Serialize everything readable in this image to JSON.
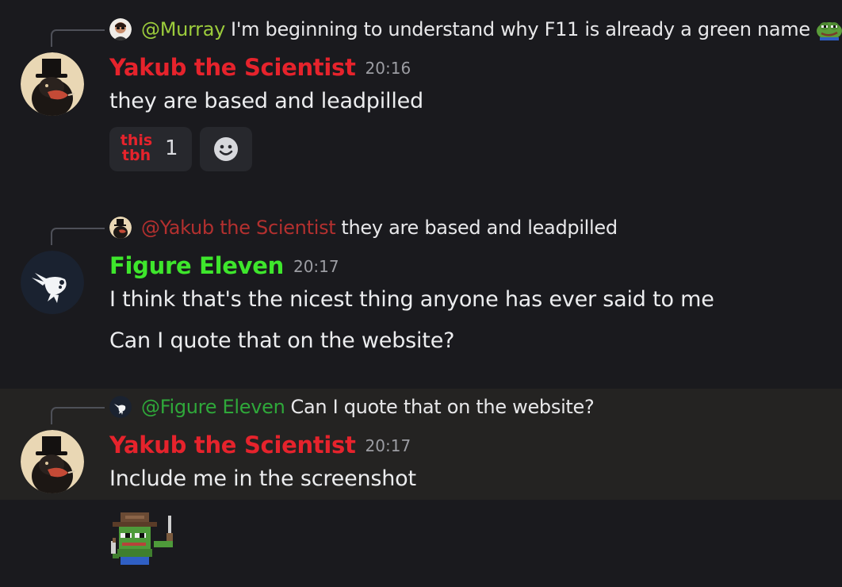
{
  "messages": [
    {
      "reply": {
        "mention": "@Murray",
        "text": "I'm beginning to understand why F11 is already a green name",
        "mention_color": "#9ccc3c",
        "emoji": "pepe-smug-emoji"
      },
      "author": "Yakub the Scientist",
      "author_color": "#e6232c",
      "timestamp": "20:16",
      "lines": [
        "they are based and leadpilled"
      ],
      "reaction": {
        "emoji_line1": "this",
        "emoji_line2": "tbh",
        "count": "1"
      }
    },
    {
      "reply": {
        "mention": "@Yakub the Scientist",
        "text": "they are based and leadpilled",
        "mention_color": "#b3302f"
      },
      "author": "Figure Eleven",
      "author_color": "#3ee62c",
      "timestamp": "20:17",
      "lines": [
        "I think that's the nicest thing anyone has ever said to me",
        "Can I quote that on the website?"
      ]
    },
    {
      "reply": {
        "mention": "@Figure Eleven",
        "text": "Can I quote that on the website?",
        "mention_color": "#2fa83a"
      },
      "author": "Yakub the Scientist",
      "author_color": "#e6232c",
      "timestamp": "20:17",
      "lines": [
        "Include me in the screenshot"
      ],
      "sticker": "pepe-cowboy-sticker"
    }
  ]
}
